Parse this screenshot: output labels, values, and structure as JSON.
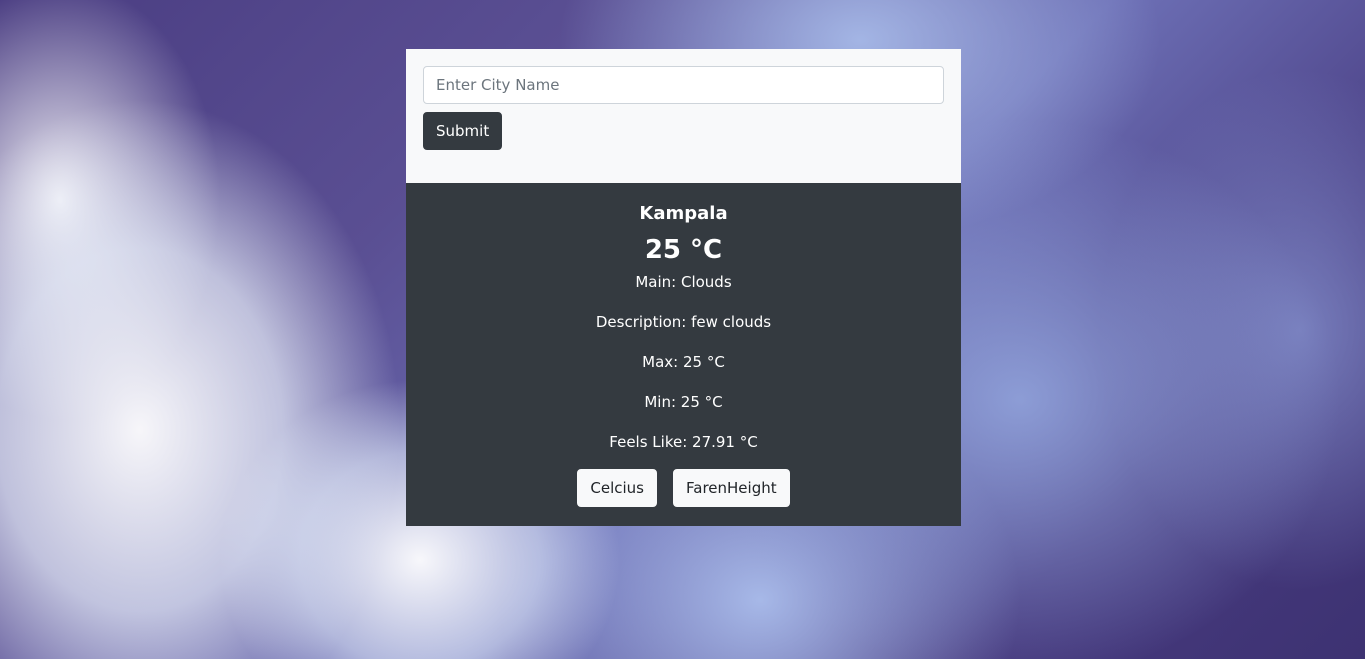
{
  "search": {
    "placeholder": "Enter City Name",
    "value": "",
    "submit_label": "Submit"
  },
  "weather": {
    "city": "Kampala",
    "temperature": "25 °C",
    "main": "Main: Clouds",
    "description": "Description: few clouds",
    "max": "Max: 25 °C",
    "min": "Min: 25 °C",
    "feels_like": "Feels Like: 27.91 °C"
  },
  "units": {
    "celsius_label": "Celcius",
    "fahrenheit_label": "FarenHeight"
  },
  "colors": {
    "form_background": "#f8f9fa",
    "result_background": "#343a40",
    "submit_button": "#343a40"
  }
}
